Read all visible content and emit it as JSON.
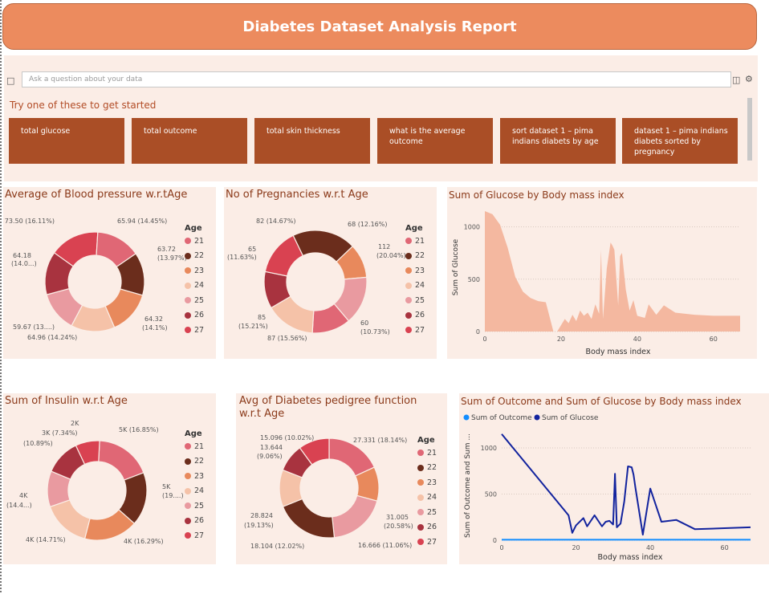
{
  "report": {
    "title": "Diabetes Dataset Analysis Report"
  },
  "qa": {
    "placeholder": "Ask a question about your data",
    "try_label": "Try one of these to get started",
    "suggestions": [
      "total glucose",
      "total outcome",
      "total skin thickness",
      "what is the average outcome",
      "sort dataset 1 – pima indians diabets by age",
      "dataset 1 – pima indians diabets sorted by pregnancy"
    ]
  },
  "legend": {
    "title": "Age",
    "ages": [
      "21",
      "22",
      "23",
      "24",
      "25",
      "26",
      "27"
    ]
  },
  "colors": {
    "age": [
      "#e06775",
      "#6b2d1c",
      "#e8895c",
      "#f5c2a8",
      "#e99aa0",
      "#a8333f",
      "#d94251"
    ],
    "area": "#f4b8a0",
    "outcome": "#118dff",
    "glucose": "#12239e"
  },
  "chart_data": [
    {
      "type": "pie",
      "title": "Average of Blood pressure w.r.tAge",
      "legend_title": "Age",
      "categories": [
        "21",
        "22",
        "23",
        "24",
        "25",
        "26",
        "27"
      ],
      "values": [
        65.94,
        63.72,
        64.32,
        64.96,
        59.67,
        64.18,
        73.5
      ],
      "labels": [
        "65.94 (14.45%)",
        "63.72 (13.97%)",
        "64.32 (14.1%)",
        "64.96 (14.24%)",
        "59.67 (13....)",
        "64.18 (14.0...)",
        "73.50 (16.11%)"
      ]
    },
    {
      "type": "pie",
      "title": "No of Pregnancies w.r.t Age",
      "legend_title": "Age",
      "categories": [
        "21",
        "22",
        "23",
        "24",
        "25",
        "26",
        "27"
      ],
      "values": [
        68,
        112,
        60,
        87,
        85,
        65,
        82
      ],
      "order": [
        "22",
        "23",
        "25",
        "21",
        "24",
        "26",
        "27"
      ],
      "labels": [
        "82 (14.67%)",
        "68 (12.16%)",
        "112 (20.04%)",
        "60 (10.73%)",
        "87 (15.56%)",
        "85 (15.21%)",
        "65 (11.63%)"
      ]
    },
    {
      "type": "area",
      "title": "Sum of Glucose by Body mass index",
      "xlabel": "Body mass index",
      "ylabel": "Sum of Glucose",
      "xlim": [
        0,
        67
      ],
      "ylim": [
        0,
        1150
      ],
      "xticks": [
        0,
        20,
        40,
        60
      ],
      "yticks": [
        0,
        500,
        1000
      ],
      "x": [
        0,
        2,
        4,
        6,
        8,
        10,
        12,
        14,
        16,
        18,
        19,
        20,
        21,
        22,
        23,
        24,
        25,
        26,
        27,
        28,
        29,
        30,
        30.5,
        31,
        32,
        33,
        33.5,
        34,
        35,
        35.5,
        36,
        37,
        38,
        39,
        40,
        41,
        42,
        43,
        45,
        47,
        50,
        55,
        60,
        65,
        67
      ],
      "y": [
        1150,
        1120,
        1020,
        800,
        520,
        380,
        320,
        290,
        280,
        0,
        0,
        60,
        120,
        80,
        160,
        100,
        200,
        150,
        180,
        120,
        260,
        170,
        780,
        120,
        600,
        850,
        820,
        780,
        250,
        720,
        750,
        400,
        200,
        300,
        150,
        140,
        130,
        260,
        160,
        250,
        180,
        160,
        150,
        150,
        150
      ]
    },
    {
      "type": "pie",
      "title": "Sum of Insulin w.r.t Age",
      "legend_title": "Age",
      "categories": [
        "21",
        "22",
        "23",
        "24",
        "25",
        "26",
        "27"
      ],
      "values": [
        4.85,
        4.59,
        4.6,
        4.14,
        3.07,
        3.07,
        2.07
      ],
      "order": [
        "21",
        "22",
        "23",
        "24",
        "25",
        "26",
        "27"
      ],
      "labels": [
        "5K (16.85%)",
        "5K (19....)",
        "4K (16.29%)",
        "4K (14.71%)",
        "4K (14.4...)",
        "3K (10.89%)",
        "2K (7.34%)"
      ]
    },
    {
      "type": "pie",
      "title": "Avg of Diabetes pedigree function w.r.t Age",
      "legend_title": "Age",
      "categories": [
        "21",
        "22",
        "23",
        "24",
        "25",
        "26",
        "27"
      ],
      "values": [
        27.331,
        31.005,
        16.666,
        18.104,
        28.824,
        13.644,
        15.096
      ],
      "order": [
        "21",
        "23",
        "25",
        "22",
        "24",
        "26",
        "27"
      ],
      "labels": [
        "27.331 (18.14%)",
        "31.005 (20.58%)",
        "16.666 (11.06%)",
        "18.104 (12.02%)",
        "28.824 (19.13%)",
        "13.644 (9.06%)",
        "15.096 (10.02%)"
      ]
    },
    {
      "type": "line",
      "title": "Sum of Outcome and Sum of Glucose by Body mass index",
      "xlabel": "Body mass index",
      "ylabel": "Sum of Outcome and Sum ...",
      "xlim": [
        0,
        67
      ],
      "ylim": [
        0,
        1200
      ],
      "xticks": [
        0,
        20,
        40,
        60
      ],
      "yticks": [
        0,
        500,
        1000
      ],
      "legend": "top-left",
      "series": [
        {
          "name": "Sum of Outcome",
          "x": [
            0,
            67
          ],
          "y": [
            5,
            5
          ]
        },
        {
          "name": "Sum of Glucose",
          "x": [
            0,
            18,
            19,
            20,
            22,
            23,
            25,
            27,
            28,
            29,
            30,
            30.5,
            31,
            32,
            33,
            34,
            35,
            35.5,
            36,
            38,
            40,
            43,
            47,
            52,
            60,
            67
          ],
          "y": [
            1150,
            270,
            80,
            160,
            240,
            150,
            270,
            150,
            200,
            210,
            170,
            720,
            140,
            180,
            420,
            800,
            790,
            710,
            570,
            60,
            560,
            200,
            220,
            120,
            130,
            140
          ]
        }
      ]
    }
  ]
}
